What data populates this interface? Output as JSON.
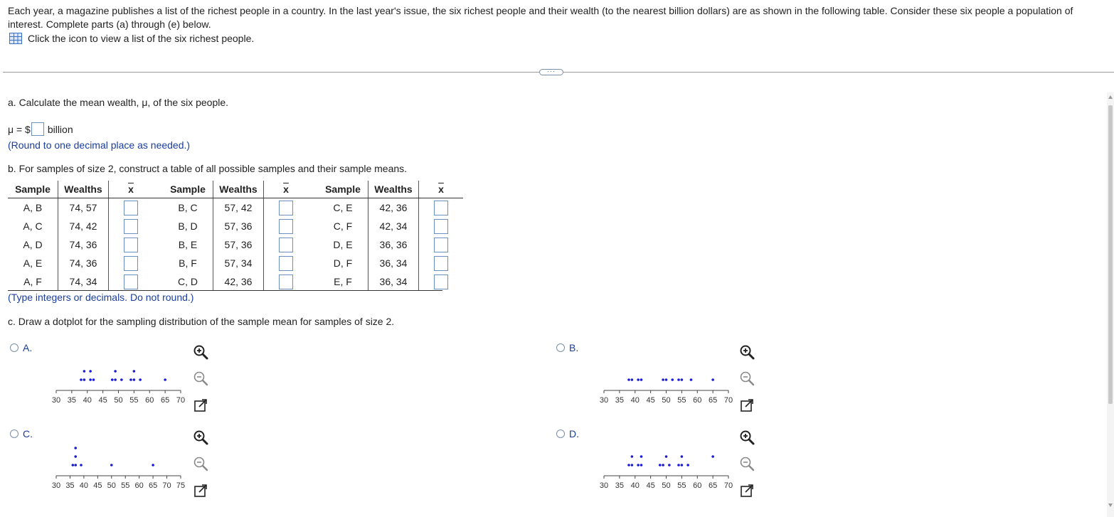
{
  "intro": {
    "text": "Each year, a magazine publishes a list of the richest people in a country. In the last year's issue, the six richest people and their wealth (to the nearest billion dollars) are as shown in the following table. Consider these six people a population of interest. Complete parts (a) through (e) below.",
    "link_text": "Click the icon to view a list of the six richest people."
  },
  "expander_text": "···",
  "part_a": {
    "question": "a. Calculate the mean wealth, μ, of the six people.",
    "prefix": "μ = $",
    "suffix": "billion",
    "note": "(Round to one decimal place as needed.)"
  },
  "part_b": {
    "question": "b. For samples of size 2, construct a table of all possible samples and their sample means.",
    "headers": [
      "Sample",
      "Wealths",
      "x"
    ],
    "rows": [
      [
        [
          "A, B",
          "74, 57"
        ],
        [
          "B, C",
          "57, 42"
        ],
        [
          "C, E",
          "42, 36"
        ]
      ],
      [
        [
          "A, C",
          "74, 42"
        ],
        [
          "B, D",
          "57, 36"
        ],
        [
          "C, F",
          "42, 34"
        ]
      ],
      [
        [
          "A, D",
          "74, 36"
        ],
        [
          "B, E",
          "57, 36"
        ],
        [
          "D, E",
          "36, 36"
        ]
      ],
      [
        [
          "A, E",
          "74, 36"
        ],
        [
          "B, F",
          "57, 34"
        ],
        [
          "D, F",
          "36, 34"
        ]
      ],
      [
        [
          "A, F",
          "74, 34"
        ],
        [
          "C, D",
          "42, 36"
        ],
        [
          "E, F",
          "36, 34"
        ]
      ]
    ],
    "note": "(Type integers or decimals. Do not round.)"
  },
  "part_c": {
    "question": "c. Draw a dotplot for the sampling distribution of the sample mean for samples of size 2.",
    "options": [
      {
        "label": "A.",
        "ticks": [
          "30",
          "35",
          "40",
          "45",
          "50",
          "55",
          "60",
          "65",
          "70"
        ],
        "dots": [
          [
            38,
            1
          ],
          [
            39,
            1
          ],
          [
            41,
            1
          ],
          [
            42,
            1
          ],
          [
            39,
            2
          ],
          [
            41,
            2
          ],
          [
            48,
            1
          ],
          [
            49,
            1
          ],
          [
            51,
            1
          ],
          [
            54,
            1
          ],
          [
            55,
            1
          ],
          [
            57,
            1
          ],
          [
            49,
            2
          ],
          [
            55,
            2
          ],
          [
            65,
            1
          ]
        ]
      },
      {
        "label": "B.",
        "ticks": [
          "30",
          "35",
          "40",
          "45",
          "50",
          "55",
          "60",
          "65",
          "70"
        ],
        "dots": [
          [
            38,
            1
          ],
          [
            39,
            1
          ],
          [
            41,
            1
          ],
          [
            42,
            1
          ],
          [
            49,
            1
          ],
          [
            50,
            1
          ],
          [
            52,
            1
          ],
          [
            54,
            1
          ],
          [
            55,
            1
          ],
          [
            58,
            1
          ],
          [
            65,
            1
          ]
        ]
      },
      {
        "label": "C.",
        "ticks": [
          "30",
          "35",
          "40",
          "45",
          "50",
          "55",
          "60",
          "65",
          "70",
          "75"
        ],
        "dots": [
          [
            36,
            1
          ],
          [
            37,
            1
          ],
          [
            37,
            2
          ],
          [
            37,
            3
          ],
          [
            39,
            1
          ],
          [
            50,
            1
          ],
          [
            65,
            1
          ]
        ]
      },
      {
        "label": "D.",
        "ticks": [
          "30",
          "35",
          "40",
          "45",
          "50",
          "55",
          "60",
          "65",
          "70"
        ],
        "dots": [
          [
            38,
            1
          ],
          [
            39,
            1
          ],
          [
            41,
            1
          ],
          [
            42,
            1
          ],
          [
            39,
            2
          ],
          [
            42,
            2
          ],
          [
            48,
            1
          ],
          [
            49,
            1
          ],
          [
            51,
            1
          ],
          [
            54,
            1
          ],
          [
            55,
            1
          ],
          [
            57,
            1
          ],
          [
            50,
            2
          ],
          [
            55,
            2
          ],
          [
            65,
            2
          ]
        ]
      }
    ]
  },
  "colors": {
    "dot": "#1a1adb",
    "link_blue": "#1a3e9e",
    "box_border": "#6b8fbf"
  },
  "icons": [
    "table-grid-icon",
    "zoom-in-icon",
    "zoom-out-icon",
    "open-external-icon"
  ]
}
